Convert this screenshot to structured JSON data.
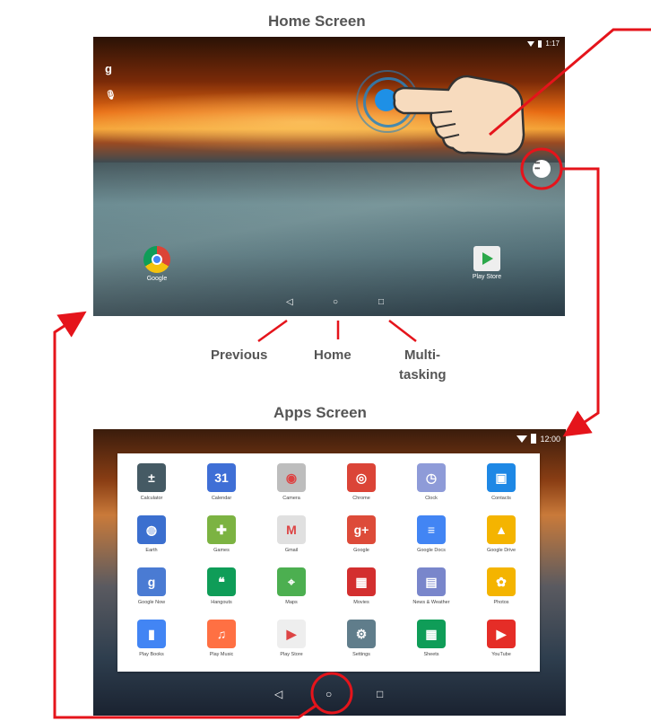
{
  "home_screen": {
    "title": "Home Screen",
    "status_time": "1:17",
    "left_icons": [
      "g",
      "🎙"
    ],
    "apps": [
      {
        "label": "Google",
        "icon": "chrome-icon"
      },
      {
        "label": "Play Store",
        "icon": "play-store-icon"
      }
    ],
    "nav_labels": {
      "previous": "Previous",
      "home": "Home",
      "multitasking_line1": "Multi-",
      "multitasking_line2": "tasking"
    },
    "nav_glyphs": {
      "back": "◁",
      "home": "○",
      "recents": "□"
    }
  },
  "apps_screen": {
    "title": "Apps Screen",
    "status_time": "12:00",
    "nav_glyphs": {
      "back": "◁",
      "home": "○",
      "recents": "□"
    },
    "apps": [
      {
        "label": "Calculator",
        "color": "#455a64",
        "glyph": "±"
      },
      {
        "label": "Calendar",
        "color": "#3f6fd6",
        "glyph": "31"
      },
      {
        "label": "Camera",
        "color": "#bdbdbd",
        "glyph": "◉"
      },
      {
        "label": "Chrome",
        "color": "#db4437",
        "glyph": "◎"
      },
      {
        "label": "Clock",
        "color": "#8e9bd8",
        "glyph": "◷"
      },
      {
        "label": "Contacts",
        "color": "#1e88e5",
        "glyph": "▣"
      },
      {
        "label": "Earth",
        "color": "#3b6fcf",
        "glyph": "◍"
      },
      {
        "label": "Games",
        "color": "#7cb342",
        "glyph": "✚"
      },
      {
        "label": "Gmail",
        "color": "#e0e0e0",
        "glyph": "M"
      },
      {
        "label": "Google",
        "color": "#dd4b39",
        "glyph": "g+"
      },
      {
        "label": "Google Docs",
        "color": "#4285f4",
        "glyph": "≡"
      },
      {
        "label": "Google Drive",
        "color": "#f4b400",
        "glyph": "▲"
      },
      {
        "label": "Google Now",
        "color": "#4a7bd3",
        "glyph": "g"
      },
      {
        "label": "Hangouts",
        "color": "#0f9d58",
        "glyph": "❝"
      },
      {
        "label": "Maps",
        "color": "#4caf50",
        "glyph": "⌖"
      },
      {
        "label": "Movies",
        "color": "#d32f2f",
        "glyph": "▦"
      },
      {
        "label": "News & Weather",
        "color": "#7986cb",
        "glyph": "▤"
      },
      {
        "label": "Photos",
        "color": "#f4b400",
        "glyph": "✿"
      },
      {
        "label": "Play Books",
        "color": "#4285f4",
        "glyph": "▮"
      },
      {
        "label": "Play Music",
        "color": "#ff7043",
        "glyph": "♫"
      },
      {
        "label": "Play Store",
        "color": "#eeeeee",
        "glyph": "▶"
      },
      {
        "label": "Settings",
        "color": "#607d8b",
        "glyph": "⚙"
      },
      {
        "label": "Sheets",
        "color": "#0f9d58",
        "glyph": "▦"
      },
      {
        "label": "YouTube",
        "color": "#e52d27",
        "glyph": "▶"
      }
    ]
  },
  "colors": {
    "annotation_red": "#e5141b",
    "label_gray": "#555555"
  }
}
